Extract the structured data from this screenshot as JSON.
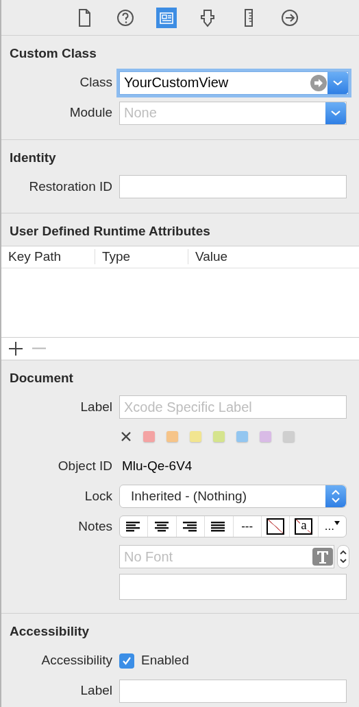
{
  "inspector_tabs": [
    {
      "kind": "file",
      "selected": false
    },
    {
      "kind": "help",
      "selected": false
    },
    {
      "kind": "identity",
      "selected": true
    },
    {
      "kind": "attributes",
      "selected": false
    },
    {
      "kind": "size",
      "selected": false
    },
    {
      "kind": "connections",
      "selected": false
    }
  ],
  "custom_class": {
    "title": "Custom Class",
    "class_label": "Class",
    "class_value": "YourCustomView",
    "module_label": "Module",
    "module_placeholder": "None"
  },
  "identity": {
    "title": "Identity",
    "restoration_label": "Restoration ID"
  },
  "runtime_attributes": {
    "title": "User Defined Runtime Attributes",
    "columns": [
      "Key Path",
      "Type",
      "Value"
    ],
    "remove_disabled": true
  },
  "document": {
    "title": "Document",
    "label_label": "Label",
    "label_placeholder": "Xcode Specific Label",
    "colors": [
      {
        "color": "#f4a3a3"
      },
      {
        "color": "#f6c489"
      },
      {
        "color": "#f2e590"
      },
      {
        "color": "#d5e48d"
      },
      {
        "color": "#93c6f0"
      },
      {
        "color": "#d9bbe6"
      },
      {
        "color": "#cfcfcf"
      }
    ],
    "object_id_label": "Object ID",
    "object_id": "Mlu-Qe-6V4",
    "lock_label": "Lock",
    "lock_value": "Inherited - (Nothing)",
    "notes_label": "Notes",
    "notes_buttons": [
      {
        "kind": "align-left"
      },
      {
        "kind": "align-center"
      },
      {
        "kind": "align-right"
      },
      {
        "kind": "justify"
      },
      {
        "kind": "text",
        "text": "---"
      },
      {
        "kind": "swatch"
      },
      {
        "kind": "swatch",
        "text": "a"
      },
      {
        "kind": "menu",
        "text": "..."
      }
    ],
    "font_placeholder": "No Font"
  },
  "accessibility": {
    "title": "Accessibility",
    "accessibility_label": "Accessibility",
    "enabled": true,
    "enabled_label": "Enabled",
    "label_label": "Label"
  }
}
